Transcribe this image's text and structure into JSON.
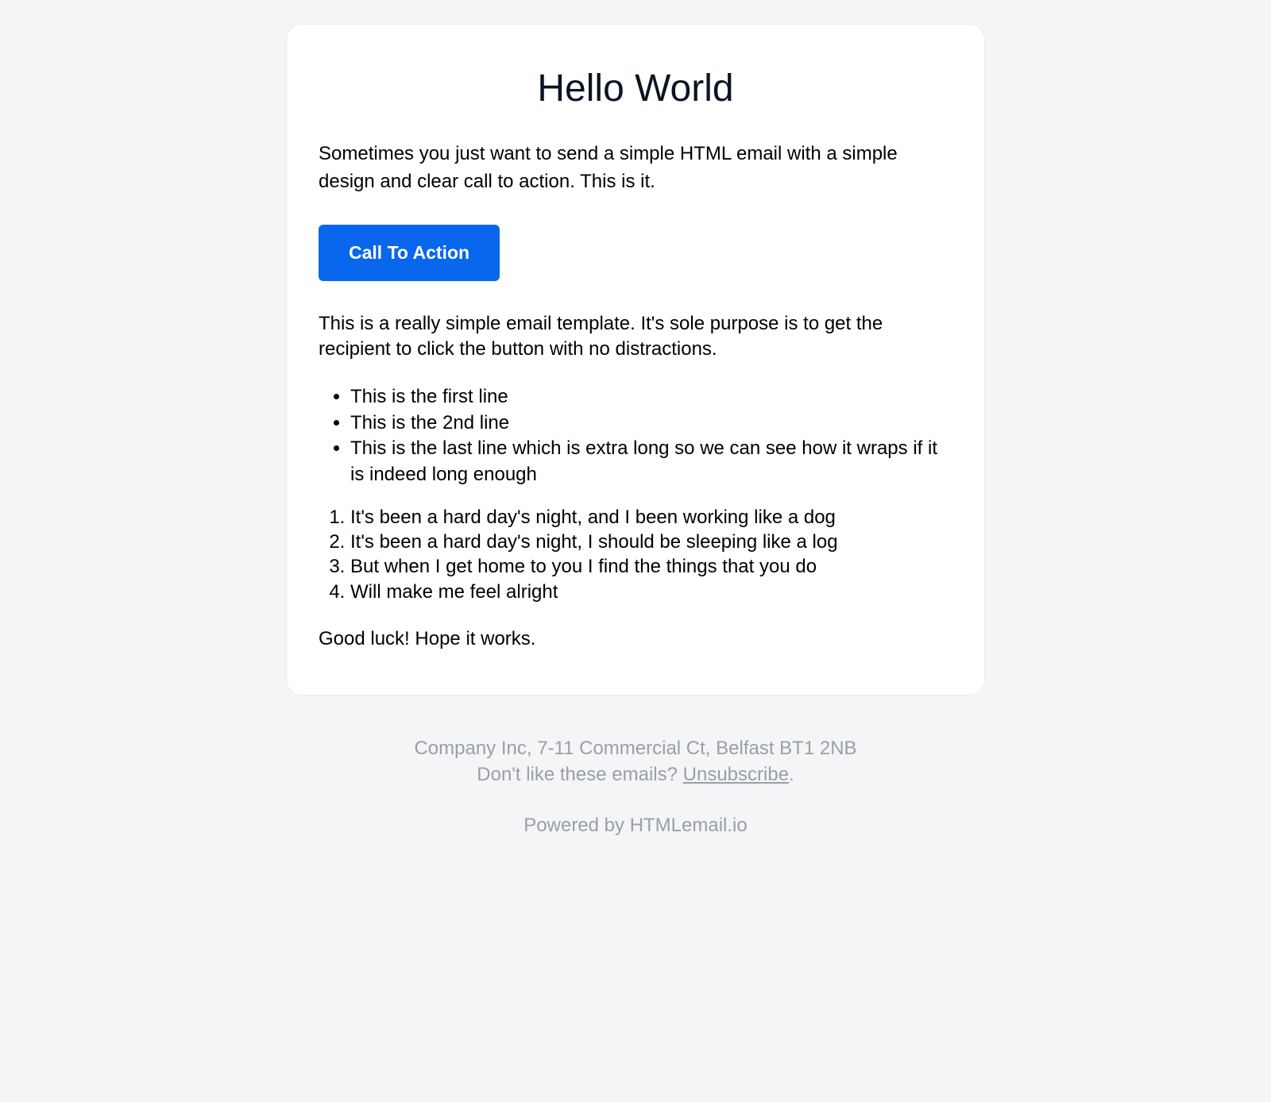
{
  "header": {
    "title": "Hello World"
  },
  "main": {
    "intro": "Sometimes you just want to send a simple HTML email with a simple design and clear call to action. This is it.",
    "cta_label": "Call To Action",
    "body": "This is a really simple email template. It's sole purpose is to get the recipient to click the button with no distractions.",
    "bullets": [
      "This is the first line",
      "This is the 2nd line",
      "This is the last line which is extra long so we can see how it wraps if it is indeed long enough"
    ],
    "numbered": [
      "It's been a hard day's night, and I been working like a dog",
      "It's been a hard day's night, I should be sleeping like a log",
      "But when I get home to you I find the things that you do",
      "Will make me feel alright"
    ],
    "closing": "Good luck! Hope it works."
  },
  "footer": {
    "address": "Company Inc, 7-11 Commercial Ct, Belfast BT1 2NB",
    "unsubscribe_prefix": "Don't like these emails? ",
    "unsubscribe_label": "Unsubscribe",
    "unsubscribe_suffix": ".",
    "powered_by": "Powered by HTMLemail.io"
  }
}
